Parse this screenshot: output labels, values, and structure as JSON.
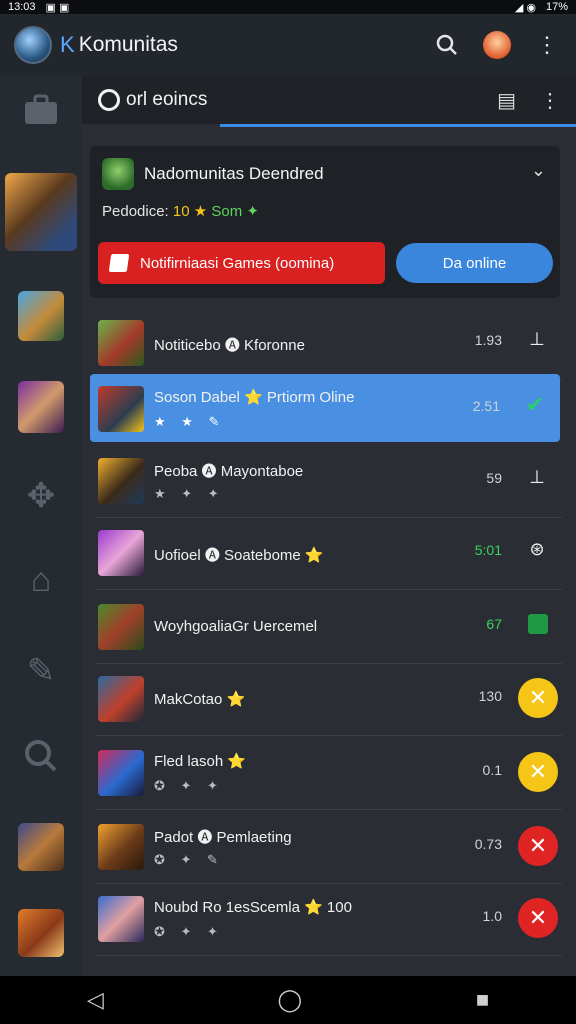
{
  "status_bar": {
    "time": "13:03",
    "battery": "17%"
  },
  "app_bar": {
    "brand_letter": "K",
    "title": "Komunitas",
    "search_icon": "search-icon",
    "profile_icon": "profile-avatar",
    "more_icon": "more-vert-icon"
  },
  "sidebar": {
    "items": [
      {
        "name": "sidebar-item-briefcase",
        "icon": "briefcase-icon"
      },
      {
        "name": "sidebar-item-hero-1",
        "icon": "hero-thumbnail"
      },
      {
        "name": "sidebar-item-hero-2",
        "icon": "hero-thumbnail"
      },
      {
        "name": "sidebar-item-hero-3",
        "icon": "hero-thumbnail"
      },
      {
        "name": "sidebar-item-puzzle",
        "icon": "puzzle-icon"
      },
      {
        "name": "sidebar-item-home",
        "icon": "home-icon"
      },
      {
        "name": "sidebar-item-pencil",
        "icon": "pencil-icon"
      },
      {
        "name": "sidebar-item-search",
        "icon": "search-icon"
      },
      {
        "name": "sidebar-item-hero-4",
        "icon": "hero-thumbnail"
      },
      {
        "name": "sidebar-item-hero-5",
        "icon": "hero-thumbnail"
      }
    ]
  },
  "subheader": {
    "title": "orl eoincs",
    "list_icon": "list-icon",
    "more_icon": "more-vert-icon"
  },
  "card": {
    "title": "Nadomunitas Deendred",
    "sub_label": "Pedodice:",
    "sub_value": "10",
    "sub_green": "Som",
    "red_button": "Notifirniaasi Games (oomina)",
    "blue_button": "Da online"
  },
  "rows": [
    {
      "title": "Notiticebo 🅐 Kforonne",
      "icons": "",
      "num": "1.93",
      "num_color": "default",
      "action": "⊥",
      "action_style": "plain"
    },
    {
      "title": "Soson Dabel ⭐ Prtiorm Oline",
      "icons": "★ ★ ✎",
      "num": "2.51",
      "num_color": "default",
      "action": "✔",
      "action_style": "check"
    },
    {
      "title": "Peoba 🅐 Mayontaboe",
      "icons": "★ ✦ ✦",
      "num": "59",
      "num_color": "default",
      "action": "⊥",
      "action_style": "plain"
    },
    {
      "title": "Uofioel 🅐 Soatebome ⭐",
      "icons": "",
      "num": "5:01",
      "num_color": "green",
      "action": "⊛",
      "action_style": "plain"
    },
    {
      "title": "WoyhgoaliaGr Uercemel",
      "icons": "",
      "num": "67",
      "num_color": "green",
      "action": "",
      "action_style": "green-square"
    },
    {
      "title": "MakCotao ⭐",
      "icons": "",
      "num": "130",
      "num_color": "default",
      "action": "✕",
      "action_style": "yellow"
    },
    {
      "title": "Fled lasoh ⭐",
      "icons": "✪ ✦ ✦",
      "num": "0.1",
      "num_color": "default",
      "action": "✕",
      "action_style": "yellow"
    },
    {
      "title": "Padot 🅐 Pemlaeting",
      "icons": "✪ ✦ ✎",
      "num": "0.73",
      "num_color": "default",
      "action": "✕",
      "action_style": "red"
    },
    {
      "title": "Noubd Ro 1esScemla ⭐ 100",
      "icons": "✪ ✦ ✦",
      "num": "1.0",
      "num_color": "default",
      "action": "✕",
      "action_style": "red"
    }
  ],
  "nav": {
    "back": "◁",
    "home": "◯",
    "recents": "■"
  }
}
